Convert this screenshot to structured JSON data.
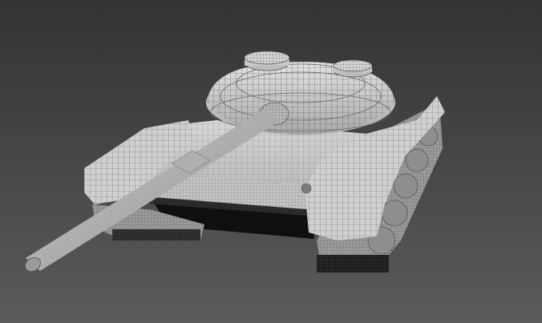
{
  "viewport": {
    "background_top": "#333333",
    "background_bottom": "#5b5b5b",
    "model_fill": "#c9c9c9",
    "model_shadow": "#8e8e8e",
    "wire_color": "#555555",
    "dark_color": "#0f0f0f"
  }
}
